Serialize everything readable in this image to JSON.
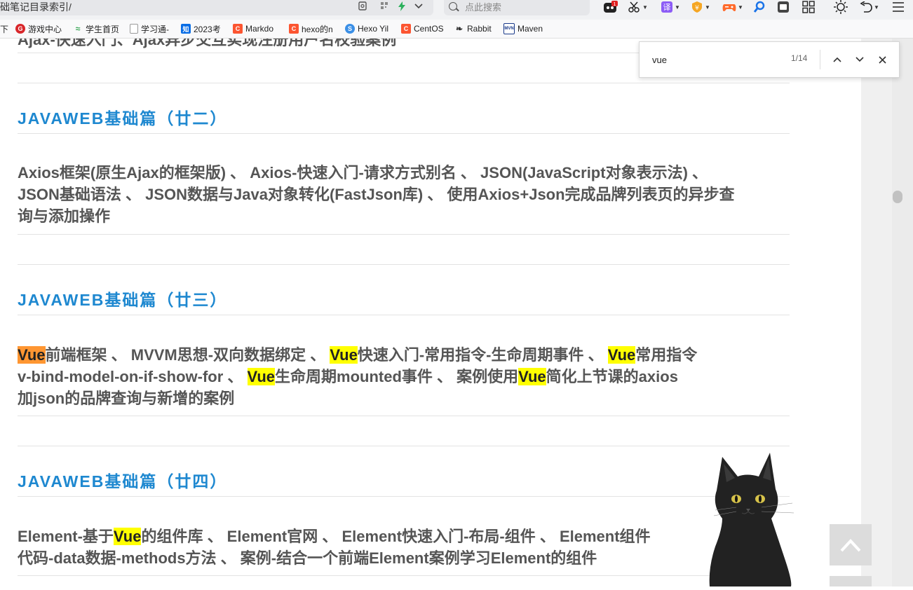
{
  "browser": {
    "url_text": "础笔记目录索引/",
    "search_placeholder": "点此搜索",
    "toolbar_icons": [
      "game-icon",
      "scissors-icon",
      "translate-icon",
      "coupon-icon",
      "gamepad-icon",
      "search-icon",
      "screenshot-icon",
      "apps-grid-icon",
      "brightness-icon",
      "undo-icon",
      "menu-icon"
    ],
    "badge_count": "1"
  },
  "bookmarks": [
    {
      "label": "下",
      "icon": "folder-icon",
      "color": "#f9f9fa"
    },
    {
      "label": "游戏中心",
      "icon": "game-center-icon",
      "color": "#d8262a",
      "glyph": "G"
    },
    {
      "label": "学生首页",
      "icon": "student-icon",
      "color": "#3aa757",
      "glyph": "≈"
    },
    {
      "label": "学习通-",
      "icon": "page-icon",
      "color": "#ffffff",
      "glyph": ""
    },
    {
      "label": "2023考",
      "icon": "zhihu-icon",
      "color": "#0a6ee6",
      "glyph": "知"
    },
    {
      "label": "Markdo",
      "icon": "csdn-icon",
      "color": "#fc5531",
      "glyph": "C"
    },
    {
      "label": "hexo的n",
      "icon": "csdn-icon",
      "color": "#fc5531",
      "glyph": "C"
    },
    {
      "label": "Hexo Yil",
      "icon": "hexo-icon",
      "color": "#3b8fe6",
      "glyph": "S"
    },
    {
      "label": "CentOS",
      "icon": "csdn-icon",
      "color": "#fc5531",
      "glyph": "C"
    },
    {
      "label": "Rabbit",
      "icon": "rabbit-icon",
      "color": "#f9f9fa",
      "glyph": "❧"
    },
    {
      "label": "Maven",
      "icon": "maven-icon",
      "color": "#ffffff",
      "glyph": "MVN"
    }
  ],
  "find": {
    "query": "vue",
    "count": "1/14"
  },
  "sections": [
    {
      "title": "JAVAWEB基础篇（廿二）",
      "lines": [
        [
          {
            "t": "Axios框架(原生Ajax的框架版) 、 Axios-快速入门-请求方式别名 、 JSON(JavaScript对象表示法) 、"
          }
        ],
        [
          {
            "t": "JSON基础语法 、 JSON数据与Java对象转化(FastJson库) 、 使用Axios+Json完成品牌列表页的异步查"
          }
        ],
        [
          {
            "t": "询与添加操作"
          }
        ]
      ]
    },
    {
      "title": "JAVAWEB基础篇（廿三）",
      "lines": [
        [
          {
            "t": "Vue",
            "h": "cur"
          },
          {
            "t": "前端框架 、 MVVM思想-双向数据绑定 、 "
          },
          {
            "t": "Vue",
            "h": "hl"
          },
          {
            "t": "快速入门-常用指令-生命周期事件 、 "
          },
          {
            "t": "Vue",
            "h": "hl"
          },
          {
            "t": "常用指令"
          }
        ],
        [
          {
            "t": "v-bind-model-on-if-show-for 、 "
          },
          {
            "t": "Vue",
            "h": "hl"
          },
          {
            "t": "生命周期mounted事件 、 案例使用"
          },
          {
            "t": "Vue",
            "h": "hl"
          },
          {
            "t": "简化上节课的axios"
          }
        ],
        [
          {
            "t": "加json的品牌查询与新增的案例"
          }
        ]
      ]
    },
    {
      "title": "JAVAWEB基础篇（廿四）",
      "lines": [
        [
          {
            "t": "Element-基于"
          },
          {
            "t": "Vue",
            "h": "hl"
          },
          {
            "t": "的组件库 、 Element官网 、 Element快速入门-布局-组件 、 Element组件"
          }
        ],
        [
          {
            "t": "代码-data数据-methods方法 、 案例-结合一个前端Element案例学习Element的组件"
          }
        ]
      ]
    }
  ],
  "colors": {
    "title": "#1e88d0",
    "text": "#555555",
    "highlight": "#ffff00",
    "highlight_current": "#ff9632"
  }
}
